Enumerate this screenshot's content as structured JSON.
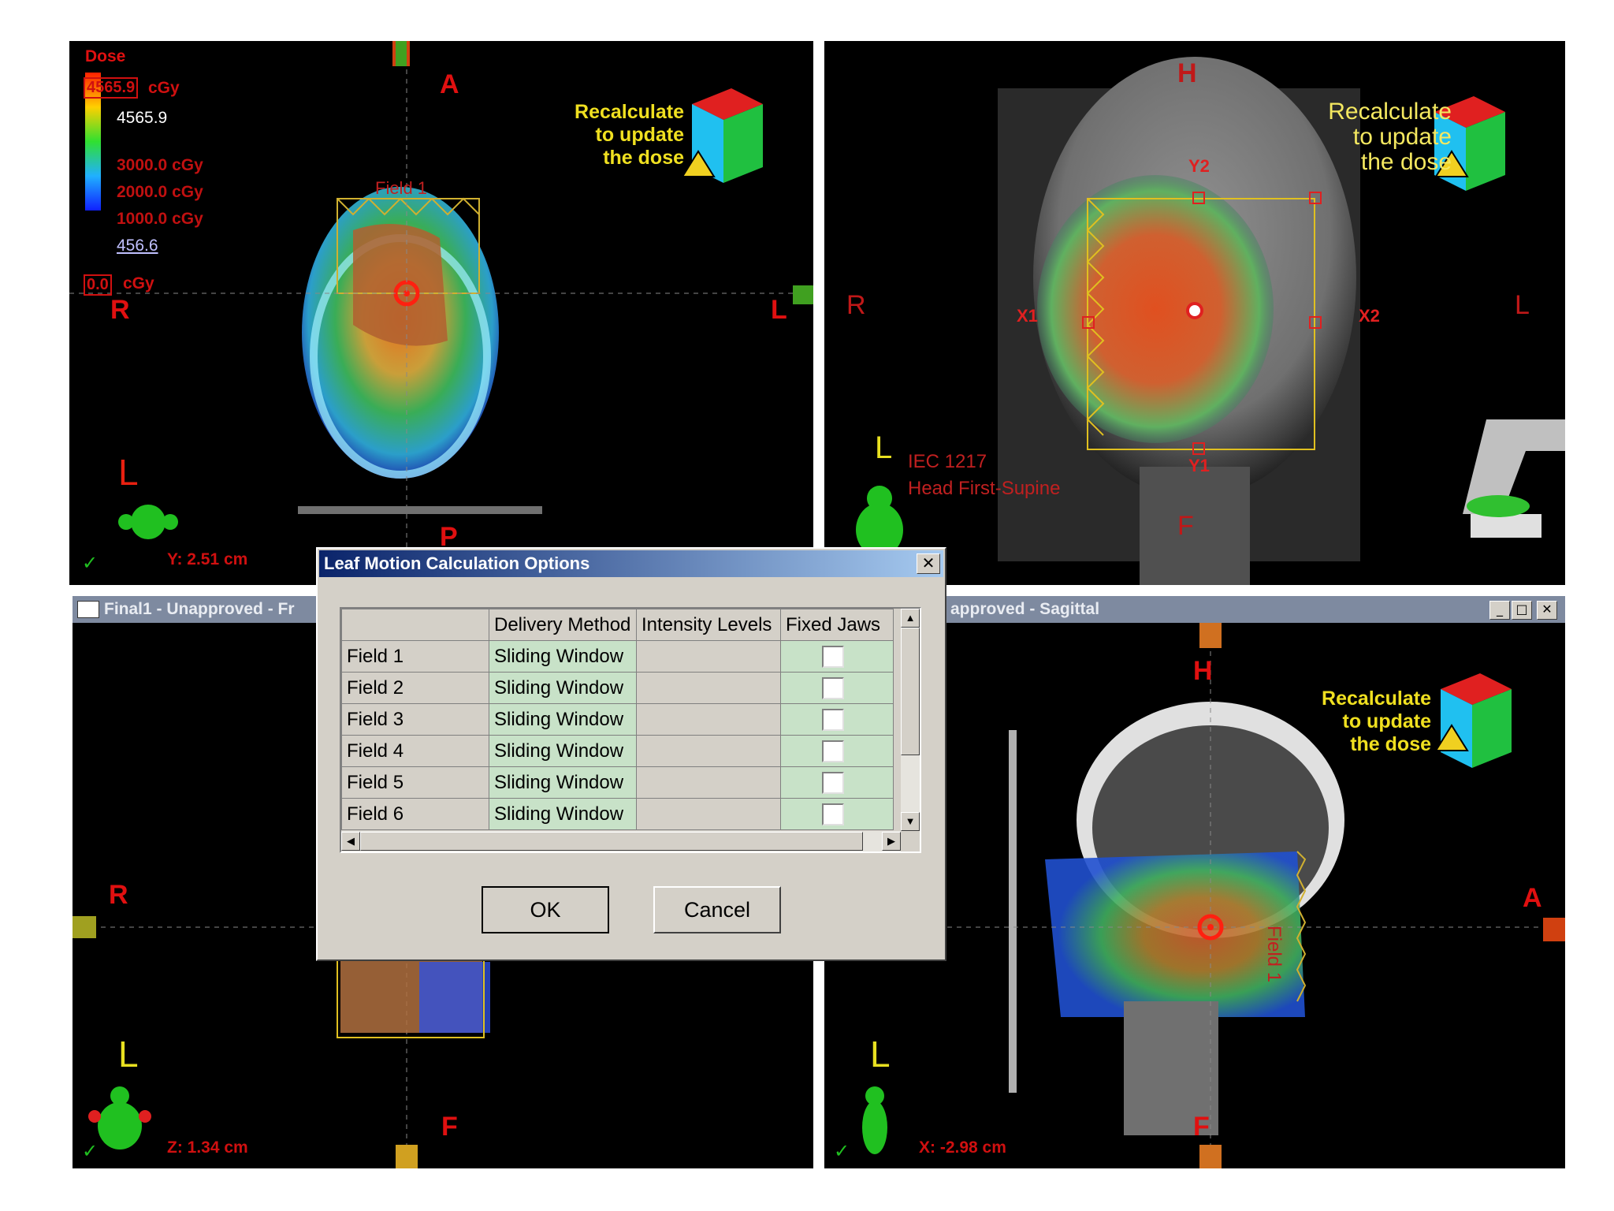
{
  "dose_legend": {
    "title": "Dose",
    "max_box": "4565.9",
    "unit": "cGy",
    "max_value": "4565.9",
    "levels": [
      "3000.0 cGy",
      "2000.0 cGy",
      "1000.0 cGy"
    ],
    "min_value": "456.6",
    "cursor_box": "0.0",
    "cursor_unit": "cGy"
  },
  "views": {
    "transverse": {
      "labels": {
        "top": "A",
        "left": "R",
        "right": "L",
        "bottom": "P",
        "orient": "L"
      },
      "field_label": "Field 1",
      "coordinate": "Y: 2.51 cm"
    },
    "frontal": {
      "labels": {
        "top": "H",
        "left": "R",
        "right": "L",
        "bottom": "F",
        "orient": "L"
      },
      "jaws": {
        "y2": "Y2",
        "y1": "Y1",
        "x1": "X1",
        "x2": "X2"
      },
      "iec": "IEC 1217",
      "patient_orientation": "Head First-Supine"
    },
    "frontal_bottom": {
      "title": "Final1  -  Unapproved - Fr",
      "labels": {
        "left": "R",
        "bottom": "F",
        "orient": "L"
      },
      "coordinate": "Z: 1.34 cm"
    },
    "sagittal": {
      "title": "approved - Sagittal",
      "labels": {
        "top": "H",
        "right": "A",
        "bottom": "F",
        "orient": "L"
      },
      "field_label": "Field 1",
      "coordinate": "X: -2.98 cm"
    }
  },
  "recalc_warning": {
    "line1": "Recalculate",
    "line2": "to update",
    "line3": "the dose"
  },
  "window_buttons": {
    "minimize": "_",
    "maximize": "□",
    "close": "✕"
  },
  "dialog": {
    "title": "Leaf Motion Calculation Options",
    "close": "✕",
    "columns": [
      "",
      "Delivery Method",
      "Intensity Levels",
      "Fixed Jaws"
    ],
    "rows": [
      {
        "field": "Field 1",
        "method": "Sliding Window",
        "intensity": "",
        "fixed_jaws": false
      },
      {
        "field": "Field 2",
        "method": "Sliding Window",
        "intensity": "",
        "fixed_jaws": false
      },
      {
        "field": "Field 3",
        "method": "Sliding Window",
        "intensity": "",
        "fixed_jaws": false
      },
      {
        "field": "Field 4",
        "method": "Sliding Window",
        "intensity": "",
        "fixed_jaws": false
      },
      {
        "field": "Field 5",
        "method": "Sliding Window",
        "intensity": "",
        "fixed_jaws": false
      },
      {
        "field": "Field 6",
        "method": "Sliding Window",
        "intensity": "",
        "fixed_jaws": false
      }
    ],
    "ok_label": "OK",
    "cancel_label": "Cancel"
  },
  "colors": {
    "label_red": "#e01010",
    "recalc_yellow": "#f0e020",
    "grid_green": "#c8e2c8",
    "dialog_gray": "#d4d0c8",
    "title_blue": "#0a246a"
  }
}
